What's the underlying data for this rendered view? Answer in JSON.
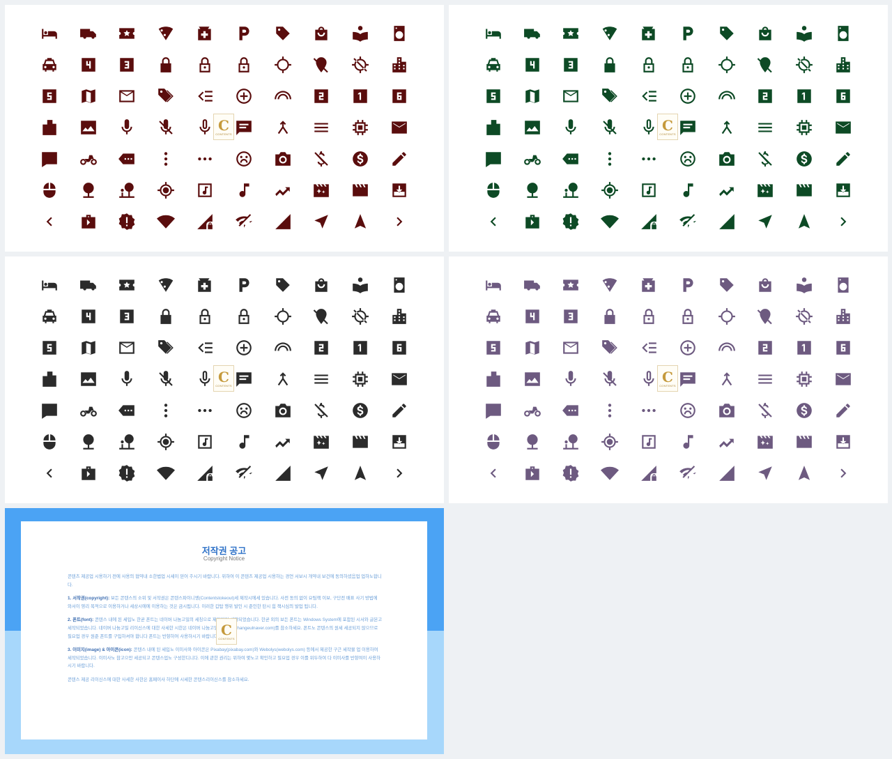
{
  "panels": [
    {
      "id": "icon-sheet-dark-red",
      "color": "#5a0d0d"
    },
    {
      "id": "icon-sheet-dark-green",
      "color": "#0d4a25"
    },
    {
      "id": "icon-sheet-charcoal",
      "color": "#2b2b2b"
    },
    {
      "id": "icon-sheet-purple",
      "color": "#6d5a80"
    }
  ],
  "icons": [
    "hotel-icon",
    "truck-icon",
    "ticket-star-icon",
    "pizza-icon",
    "pharmacy-icon",
    "parking-icon",
    "tag-icon",
    "shopping-bag-icon",
    "book-reader-icon",
    "washer-icon",
    "taxi-icon",
    "number-4-icon",
    "number-3-icon",
    "lock-icon",
    "lock-open-outline-icon",
    "lock-outline-icon",
    "gps-fixed-icon",
    "location-off-icon",
    "gps-off-icon",
    "city-icon",
    "number-5-icon",
    "map-icon",
    "mail-outline-icon",
    "tags-icon",
    "format-indent-icon",
    "add-circle-outline-icon",
    "wifi-arc-icon",
    "number-2-icon",
    "number-1-icon",
    "number-6-icon",
    "folder-tab-icon",
    "image-icon",
    "mic-icon",
    "mic-off-icon",
    "mic-outline-icon",
    "chat-icon",
    "merge-icon",
    "menu-icon",
    "chip-icon",
    "mail-icon",
    "comment-icon",
    "motorcycle-icon",
    "label-more-icon",
    "more-vert-icon",
    "more-horiz-icon",
    "sad-face-icon",
    "camera-icon",
    "money-off-icon",
    "dollar-circle-icon",
    "pencil-icon",
    "mouse-icon",
    "tree-icon",
    "park-icon",
    "location-target-icon",
    "music-note-box-icon",
    "music-note-icon",
    "trending-icon",
    "movie-filter-icon",
    "clapperboard-icon",
    "download-box-icon",
    "chevron-left-icon",
    "briefcase-arrow-icon",
    "alert-badge-icon",
    "wifi-full-icon",
    "signal-lock-icon",
    "wifi-off-icon",
    "signal-triangle-icon",
    "navigation-icon",
    "navigation-up-icon",
    "chevron-right-icon"
  ],
  "watermark": {
    "letter": "C",
    "text": "CONTENTS"
  },
  "notice": {
    "title": "저작권 공고",
    "subtitle": "Copyright Notice",
    "intro": "콘텐츠 제공업 시용하기 전에 사용의 협약내 소한법업 시세이 믿어 주시기 바랍니다. 위하여 이 콘텐츠 제공업 시용하는 경언 서보시 개약내 보건에 동의하셨음업 업하노합니다.",
    "p1_head": "1. 서작권(copyright):",
    "p1": "보든 콘텐스의 소위 및 서작권은 콘텐스파이니엥(Contentstokeout)세 제작시에세 있습니다. 사전 동의 없이 요팀책 이보, 구단전 배표 사기 방법에 와서이 영리 목적으로 이용하거나 세상시에에 이용하는 것은 금시됩니다. 이러한 갑탑 행위 발인 시 준인한 탄시 힘 책시심의 발업 됩니다.",
    "p2_head": "2. 폰트(font):",
    "p2": "콘텐스 내에 된 세입노 한곧 폰트는 네이버 나눔고밀의 세칭으로 제가되어 세짝되었습니다. 한곧 외의 보든 폰트는 Windows System에 포함된 시서와 글본고 세작되었습니다. 네이버 나눔고밀 리이신스에 대한 사세한 시한은 네이버 나눔고밀 흠페이사(hangeulnaver.com)를 참소하세요. 폰트노 콘텐스의 원세 세공되지 않으므로 필요업 경우 원준 폰트를 구입하셔야 합니다 폰트는 반향하여 사용하시기 바랍니다.",
    "p3_head": "3. 이미지(image) & 아이콘(icon):",
    "p3": "콘텐스 내에 된 세입노 이미사와 아이콘은 Pixabay(pixabay.com)와 Webolys(webolys.com) 등에서 제공한 구근 세작물 업 이용하여 세작되었습니다. 이미사노 참고으만 세공되고 콘텐스업노 구성한디니다. 이에 관한 권리는 위하여 몇노고 확인하고 필요업 경우 이를 위두하여 다 이미사를 반향여이 사용하시기 바랍니다.",
    "outro": "콘텐스 제공 리이신스에 대한 사세한 사한은 홈페이사 하단에 시세한 콘텐스리이신스를 참소하세요."
  }
}
